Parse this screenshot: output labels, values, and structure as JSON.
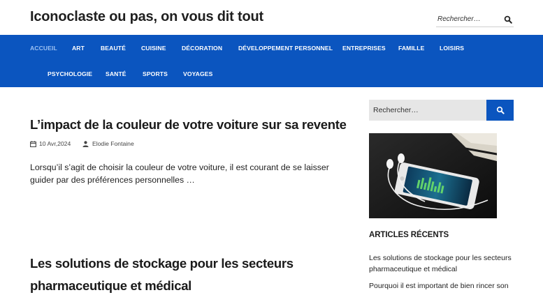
{
  "header": {
    "site_title": "Iconoclaste ou pas, on vous dit tout",
    "search_placeholder": "Rechercher…",
    "search_icon": "search-icon"
  },
  "nav": {
    "row1": [
      "ACCUEIL",
      "ART",
      "BEAUTÉ",
      "CUISINE",
      "DÉCORATION",
      "DÉVELOPPEMENT PERSONNEL",
      "ENTREPRISES",
      "FAMILLE",
      "LOISIRS"
    ],
    "row2": [
      "PSYCHOLOGIE",
      "SANTÉ",
      "SPORTS",
      "VOYAGES"
    ],
    "active": "ACCUEIL"
  },
  "posts": [
    {
      "title": "L’impact de la couleur de votre voiture sur sa revente",
      "date": "10 Avr,2024",
      "author": "Elodie Fontaine",
      "excerpt": "Lorsqu’il s’agit de choisir la couleur de votre voiture, il est courant de se laisser guider par des préférences personnelles …"
    },
    {
      "title_line1": "Les solutions de stockage pour les secteurs",
      "title_line2": "pharmaceutique et médical"
    }
  ],
  "sidebar": {
    "search_placeholder": "Rechercher…",
    "recent_heading": "ARTICLES RÉCENTS",
    "recent": [
      {
        "line1": "Les solutions de stockage pour les secteurs",
        "line2": "pharmaceutique et médical"
      },
      {
        "line1": "Pourquoi il est important de bien rincer son",
        "line2": ""
      }
    ]
  },
  "colors": {
    "nav_bg": "#0b55bf",
    "nav_active": "#9cc1f2",
    "search_btn_bg": "#0b55bf"
  }
}
